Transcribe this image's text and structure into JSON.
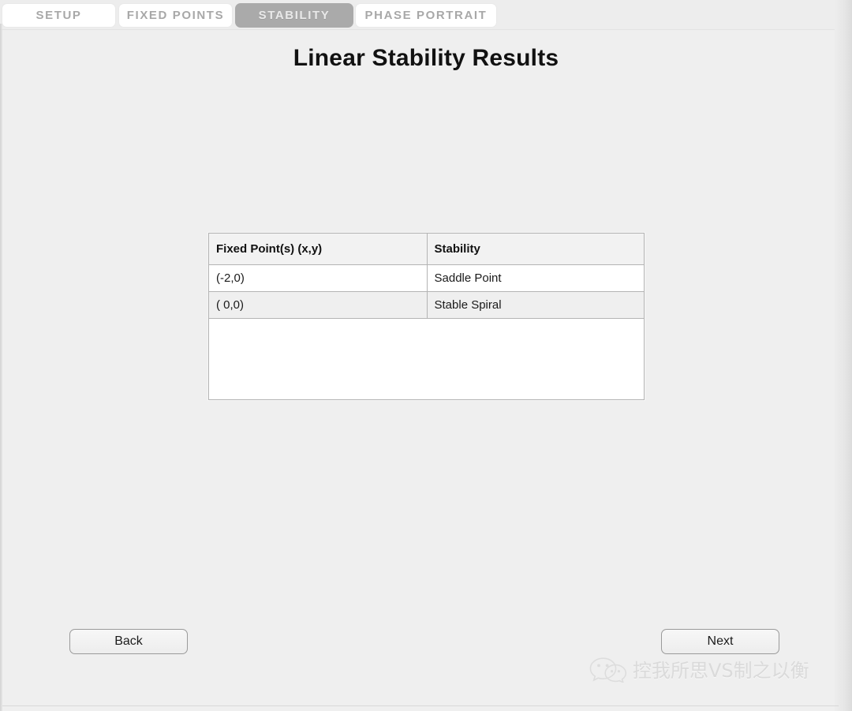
{
  "window": {
    "background_color": "#efefef"
  },
  "tabbar": {
    "tabs": [
      {
        "label": "SETUP",
        "active": false
      },
      {
        "label": "FIXED POINTS",
        "active": false
      },
      {
        "label": "STABILITY",
        "active": true
      },
      {
        "label": "PHASE PORTRAIT",
        "active": false
      }
    ],
    "active_tab_bg": "#aaaaaa",
    "inactive_tab_bg": "#ffffff",
    "inactive_tab_color": "#a8a8a8"
  },
  "page": {
    "title": "Linear Stability Results"
  },
  "results": {
    "columns": [
      "Fixed Point(s) (x,y)",
      "Stability"
    ],
    "rows": [
      {
        "fixed_point": "(-2,0)",
        "stability": "Saddle Point"
      },
      {
        "fixed_point": "( 0,0)",
        "stability": "Stable Spiral"
      }
    ],
    "border_color": "#b4b4b4",
    "header_bg": "#f2f2f2",
    "alt_row_bg": "#efefef"
  },
  "footer": {
    "back_label": "Back",
    "next_label": "Next"
  },
  "watermark": {
    "icon": "wechat-icon",
    "text": "控我所思VS制之以衡",
    "color": "#c9c9c9"
  }
}
